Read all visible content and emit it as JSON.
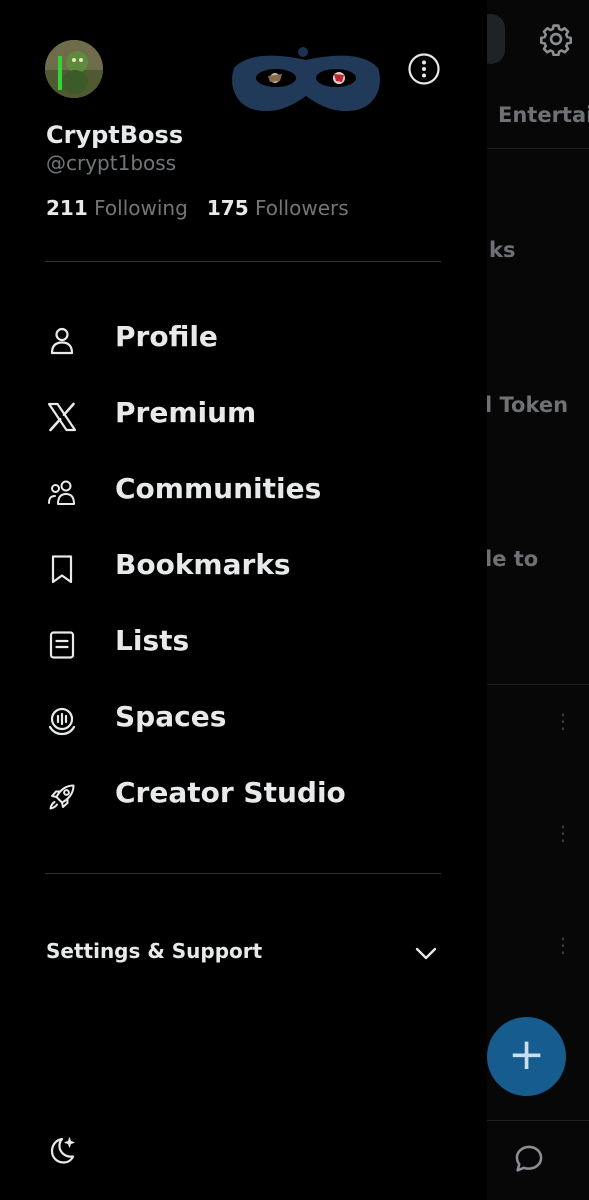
{
  "background": {
    "tab_label": "Entertai",
    "fragments": [
      "ks",
      "l Token",
      "le to"
    ]
  },
  "profile": {
    "display_name": "CryptBoss",
    "handle": "@crypt1boss",
    "following_count": "211",
    "following_label": "Following",
    "followers_count": "175",
    "followers_label": "Followers"
  },
  "nav": {
    "items": [
      {
        "label": "Profile",
        "icon": "person-icon"
      },
      {
        "label": "Premium",
        "icon": "x-logo-icon"
      },
      {
        "label": "Communities",
        "icon": "communities-icon"
      },
      {
        "label": "Bookmarks",
        "icon": "bookmark-icon"
      },
      {
        "label": "Lists",
        "icon": "list-icon"
      },
      {
        "label": "Spaces",
        "icon": "spaces-icon"
      },
      {
        "label": "Creator Studio",
        "icon": "rocket-icon"
      }
    ]
  },
  "settings": {
    "label": "Settings & Support"
  },
  "fab": {
    "symbol": "+"
  },
  "colors": {
    "background": "#000000",
    "text": "#e7e9ea",
    "muted": "#71767b",
    "divider": "#2f3336",
    "fab": "#165c8f"
  }
}
